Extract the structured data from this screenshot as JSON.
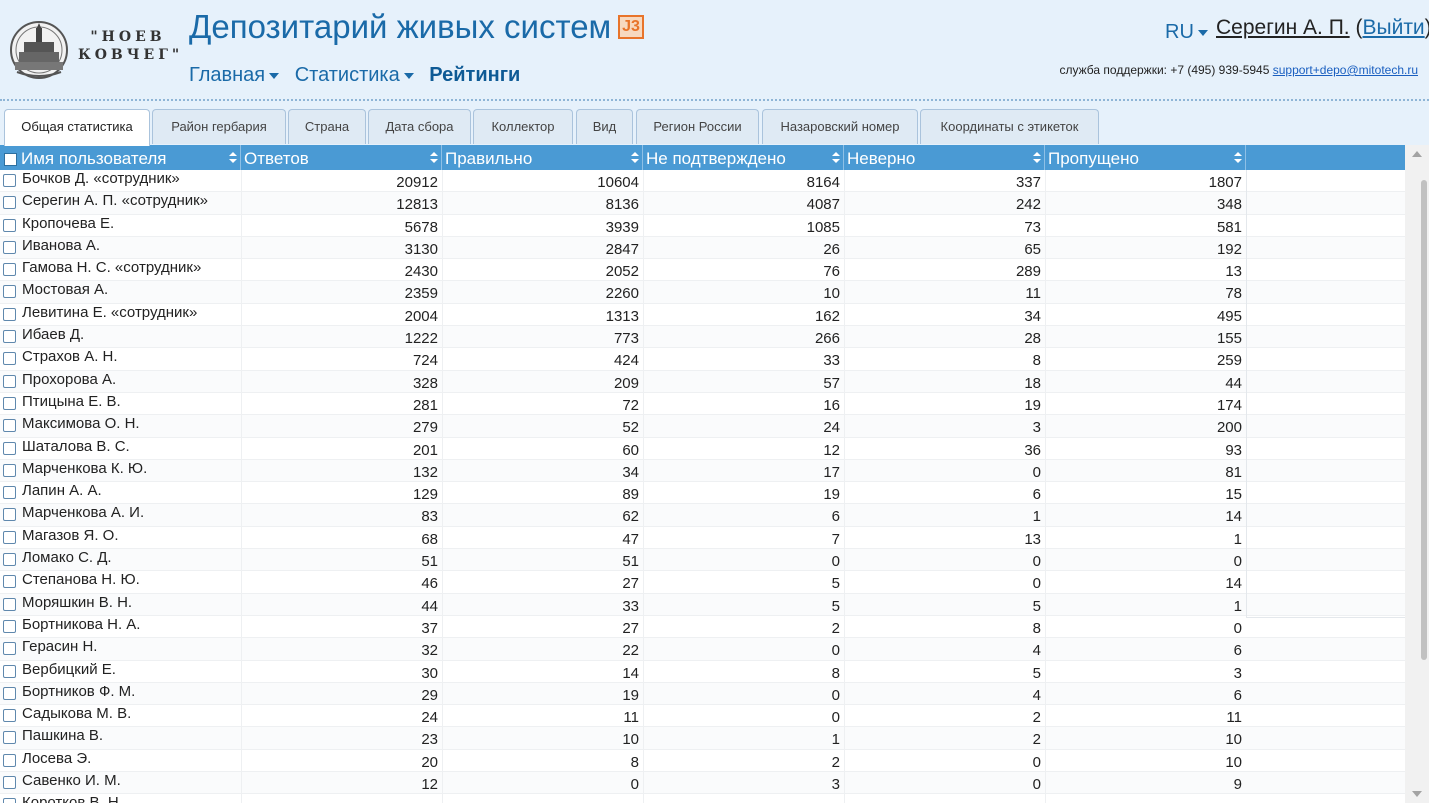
{
  "header": {
    "logo_text": "\"НОЕВ КОВЧЕГ\"",
    "title": "Депозитарий живых систем",
    "badge_text": "J3",
    "nav": [
      {
        "label": "Главная",
        "has_dropdown": true,
        "active": false
      },
      {
        "label": "Статистика",
        "has_dropdown": true,
        "active": false
      },
      {
        "label": "Рейтинги",
        "has_dropdown": false,
        "active": true
      }
    ],
    "language": "RU",
    "user_name": "Серегин А. П.",
    "logout_open": "(",
    "logout_label": "Выйти",
    "logout_close": ")",
    "support_label": "служба поддержки: +7 (495) 939-5945",
    "support_email": "support+depo@mitotech.ru"
  },
  "tabs": [
    "Общая статистика",
    "Район гербария",
    "Страна",
    "Дата сбора",
    "Коллектор",
    "Вид",
    "Регион России",
    "Назаровский номер",
    "Координаты с этикеток"
  ],
  "active_tab": "Общая статистика",
  "colors": {
    "header_bg": "#e6f1fb",
    "accent": "#1a6aa8",
    "grid_header": "#4a9ad4"
  },
  "grid": {
    "columns": [
      "Имя пользователя",
      "Ответов",
      "Правильно",
      "Не подтверждено",
      "Неверно",
      "Пропущено"
    ],
    "rows": [
      [
        "Бочков Д. «сотрудник»",
        "20912",
        "10604",
        "8164",
        "337",
        "1807"
      ],
      [
        "Серегин А. П. «сотрудник»",
        "12813",
        "8136",
        "4087",
        "242",
        "348"
      ],
      [
        "Кропочева Е.",
        "5678",
        "3939",
        "1085",
        "73",
        "581"
      ],
      [
        "Иванова А.",
        "3130",
        "2847",
        "26",
        "65",
        "192"
      ],
      [
        "Гамова Н. С. «сотрудник»",
        "2430",
        "2052",
        "76",
        "289",
        "13"
      ],
      [
        "Мостовая А.",
        "2359",
        "2260",
        "10",
        "11",
        "78"
      ],
      [
        "Левитина Е. «сотрудник»",
        "2004",
        "1313",
        "162",
        "34",
        "495"
      ],
      [
        "Ибаев Д.",
        "1222",
        "773",
        "266",
        "28",
        "155"
      ],
      [
        "Страхов А. Н.",
        "724",
        "424",
        "33",
        "8",
        "259"
      ],
      [
        "Прохорова А.",
        "328",
        "209",
        "57",
        "18",
        "44"
      ],
      [
        "Птицына Е. В.",
        "281",
        "72",
        "16",
        "19",
        "174"
      ],
      [
        "Максимова О. Н.",
        "279",
        "52",
        "24",
        "3",
        "200"
      ],
      [
        "Шаталова В. С.",
        "201",
        "60",
        "12",
        "36",
        "93"
      ],
      [
        "Марченкова К. Ю.",
        "132",
        "34",
        "17",
        "0",
        "81"
      ],
      [
        "Лапин А. А.",
        "129",
        "89",
        "19",
        "6",
        "15"
      ],
      [
        "Марченкова А. И.",
        "83",
        "62",
        "6",
        "1",
        "14"
      ],
      [
        "Магазов Я. О.",
        "68",
        "47",
        "7",
        "13",
        "1"
      ],
      [
        "Ломако С. Д.",
        "51",
        "51",
        "0",
        "0",
        "0"
      ],
      [
        "Степанова Н. Ю.",
        "46",
        "27",
        "5",
        "0",
        "14"
      ],
      [
        "Моряшкин В. Н.",
        "44",
        "33",
        "5",
        "5",
        "1"
      ],
      [
        "Бортникова Н. А.",
        "37",
        "27",
        "2",
        "8",
        "0"
      ],
      [
        "Герасин Н.",
        "32",
        "22",
        "0",
        "4",
        "6"
      ],
      [
        "Вербицкий Е.",
        "30",
        "14",
        "8",
        "5",
        "3"
      ],
      [
        "Бортников Ф. М.",
        "29",
        "19",
        "0",
        "4",
        "6"
      ],
      [
        "Садыкова М. В.",
        "24",
        "11",
        "0",
        "2",
        "11"
      ],
      [
        "Пашкина В.",
        "23",
        "10",
        "1",
        "2",
        "10"
      ],
      [
        "Лосева Э.",
        "20",
        "8",
        "2",
        "0",
        "10"
      ],
      [
        "Савенко И. М.",
        "12",
        "0",
        "3",
        "0",
        "9"
      ],
      [
        "Коротков В. Н.",
        "",
        "",
        "",
        "",
        ""
      ]
    ]
  }
}
